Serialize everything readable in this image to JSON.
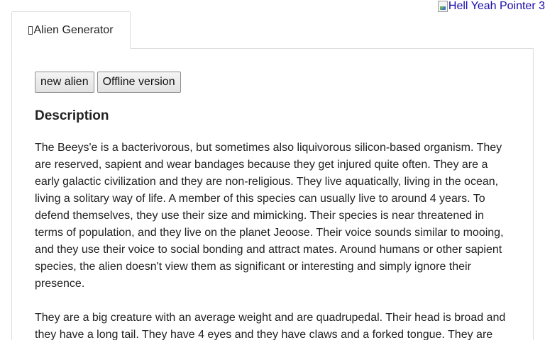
{
  "header": {
    "corner_link_alt": "Hell Yeah Pointer 3"
  },
  "tabs": [
    {
      "label": "Alien Generator"
    }
  ],
  "toolbar": {
    "new_alien_label": "new alien",
    "offline_label": "Offline version"
  },
  "content": {
    "heading": "Description",
    "paragraphs": [
      "The Beeys'e is a bacterivorous, but sometimes also liquivorous silicon-based organism. They are reserved, sapient and wear bandages because they get injured quite often. They are a early galactic civilization and they are non-religious. They live aquatically, living in the ocean, living a solitary way of life. A member of this species can usually live to around 4 years. To defend themselves, they use their size and mimicking. Their species is near threatened in terms of population, and they live on the planet Jeoose. Their voice sounds similar to mooing, and they use their voice to social bonding and attract mates. Around humans or other sapient species, the alien doesn't view them as significant or interesting and simply ignore their presence.",
      "They are a big creature with an average weight and are quadrupedal. Their head is broad and they have a long tail. They have 4 eyes and they have claws and a forked tongue. They are"
    ]
  }
}
